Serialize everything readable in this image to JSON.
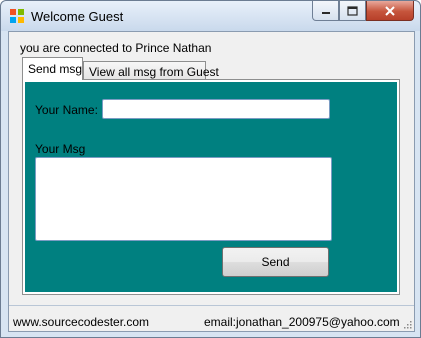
{
  "window": {
    "title": "Welcome Guest",
    "icon": "windows-app-icon",
    "controls": {
      "minimize_icon": "minimize-icon",
      "maximize_icon": "maximize-icon",
      "close_icon": "close-icon"
    }
  },
  "header": {
    "connected_text": "you are connected to Prince Nathan"
  },
  "tabs": [
    {
      "label": "Send msg",
      "active": true
    },
    {
      "label": "View all msg from Guest",
      "active": false
    }
  ],
  "form": {
    "name_label": "Your Name:",
    "name_value": "",
    "msg_label": "Your Msg",
    "msg_value": "",
    "send_label": "Send",
    "panel_color": "#008080"
  },
  "statusbar": {
    "left_text": "www.sourcecodester.com",
    "right_text": "email:jonathan_200975@yahoo.com"
  }
}
